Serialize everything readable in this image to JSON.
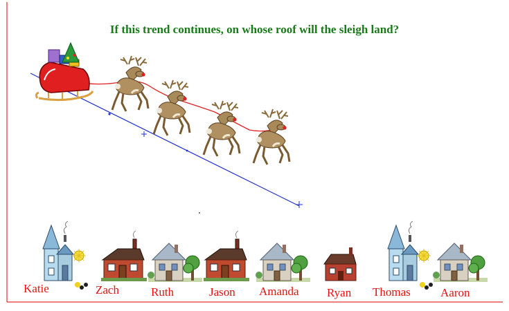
{
  "title": "If this trend continues, on whose roof will the sleigh land?",
  "colors": {
    "title": "#1a7a1a",
    "axis": "#e03030",
    "trend_line": "#2030d0",
    "names": "#e81010",
    "reins": "#e02020"
  },
  "icons": [
    "sleigh-icon",
    "reindeer-icon",
    "house-icon"
  ],
  "houses": [
    {
      "name": "Katie",
      "style": "tower"
    },
    {
      "name": "Zach",
      "style": "brick"
    },
    {
      "name": "Ruth",
      "style": "cottage"
    },
    {
      "name": "Jason",
      "style": "brick"
    },
    {
      "name": "Amanda",
      "style": "cottage"
    },
    {
      "name": "Ryan",
      "style": "brick-small"
    },
    {
      "name": "Thomas",
      "style": "tower"
    },
    {
      "name": "Aaron",
      "style": "cottage"
    }
  ]
}
